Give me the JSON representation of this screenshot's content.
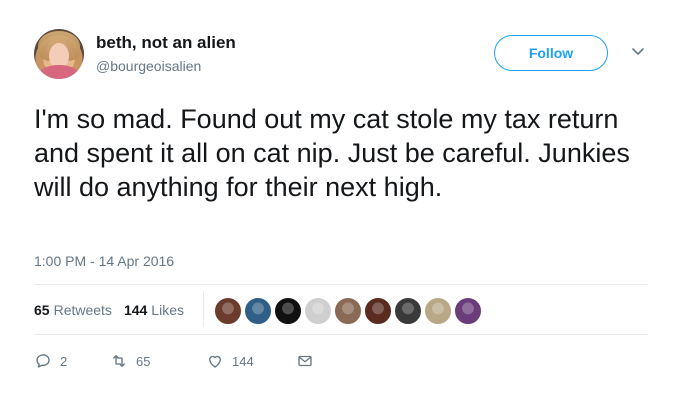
{
  "author": {
    "display_name": "beth, not an alien",
    "handle": "@bourgeoisalien"
  },
  "follow_label": "Follow",
  "tweet": {
    "text": "I'm so mad. Found out my cat stole my tax return and spent it all on cat nip. Just be careful. Junkies will do anything for their next high.",
    "timestamp": "1:00 PM - 14 Apr 2016"
  },
  "stats": {
    "retweets_count": "65",
    "retweets_label": "Retweets",
    "likes_count": "144",
    "likes_label": "Likes"
  },
  "likers": [
    {
      "color": "#6b3b2e"
    },
    {
      "color": "#2f5f86"
    },
    {
      "color": "#111111"
    },
    {
      "color": "#cfcfcf"
    },
    {
      "color": "#8a6a55"
    },
    {
      "color": "#5a2b1f"
    },
    {
      "color": "#3a3a3a"
    },
    {
      "color": "#b9a888"
    },
    {
      "color": "#6a3d7a"
    }
  ],
  "actions": {
    "reply_count": "2",
    "retweet_count": "65",
    "like_count": "144"
  },
  "colors": {
    "accent": "#1da1f2",
    "secondary_text": "#657786",
    "primary_text": "#14171a"
  },
  "icons": [
    "chevron-down-icon",
    "reply-icon",
    "retweet-icon",
    "like-icon",
    "message-icon"
  ]
}
